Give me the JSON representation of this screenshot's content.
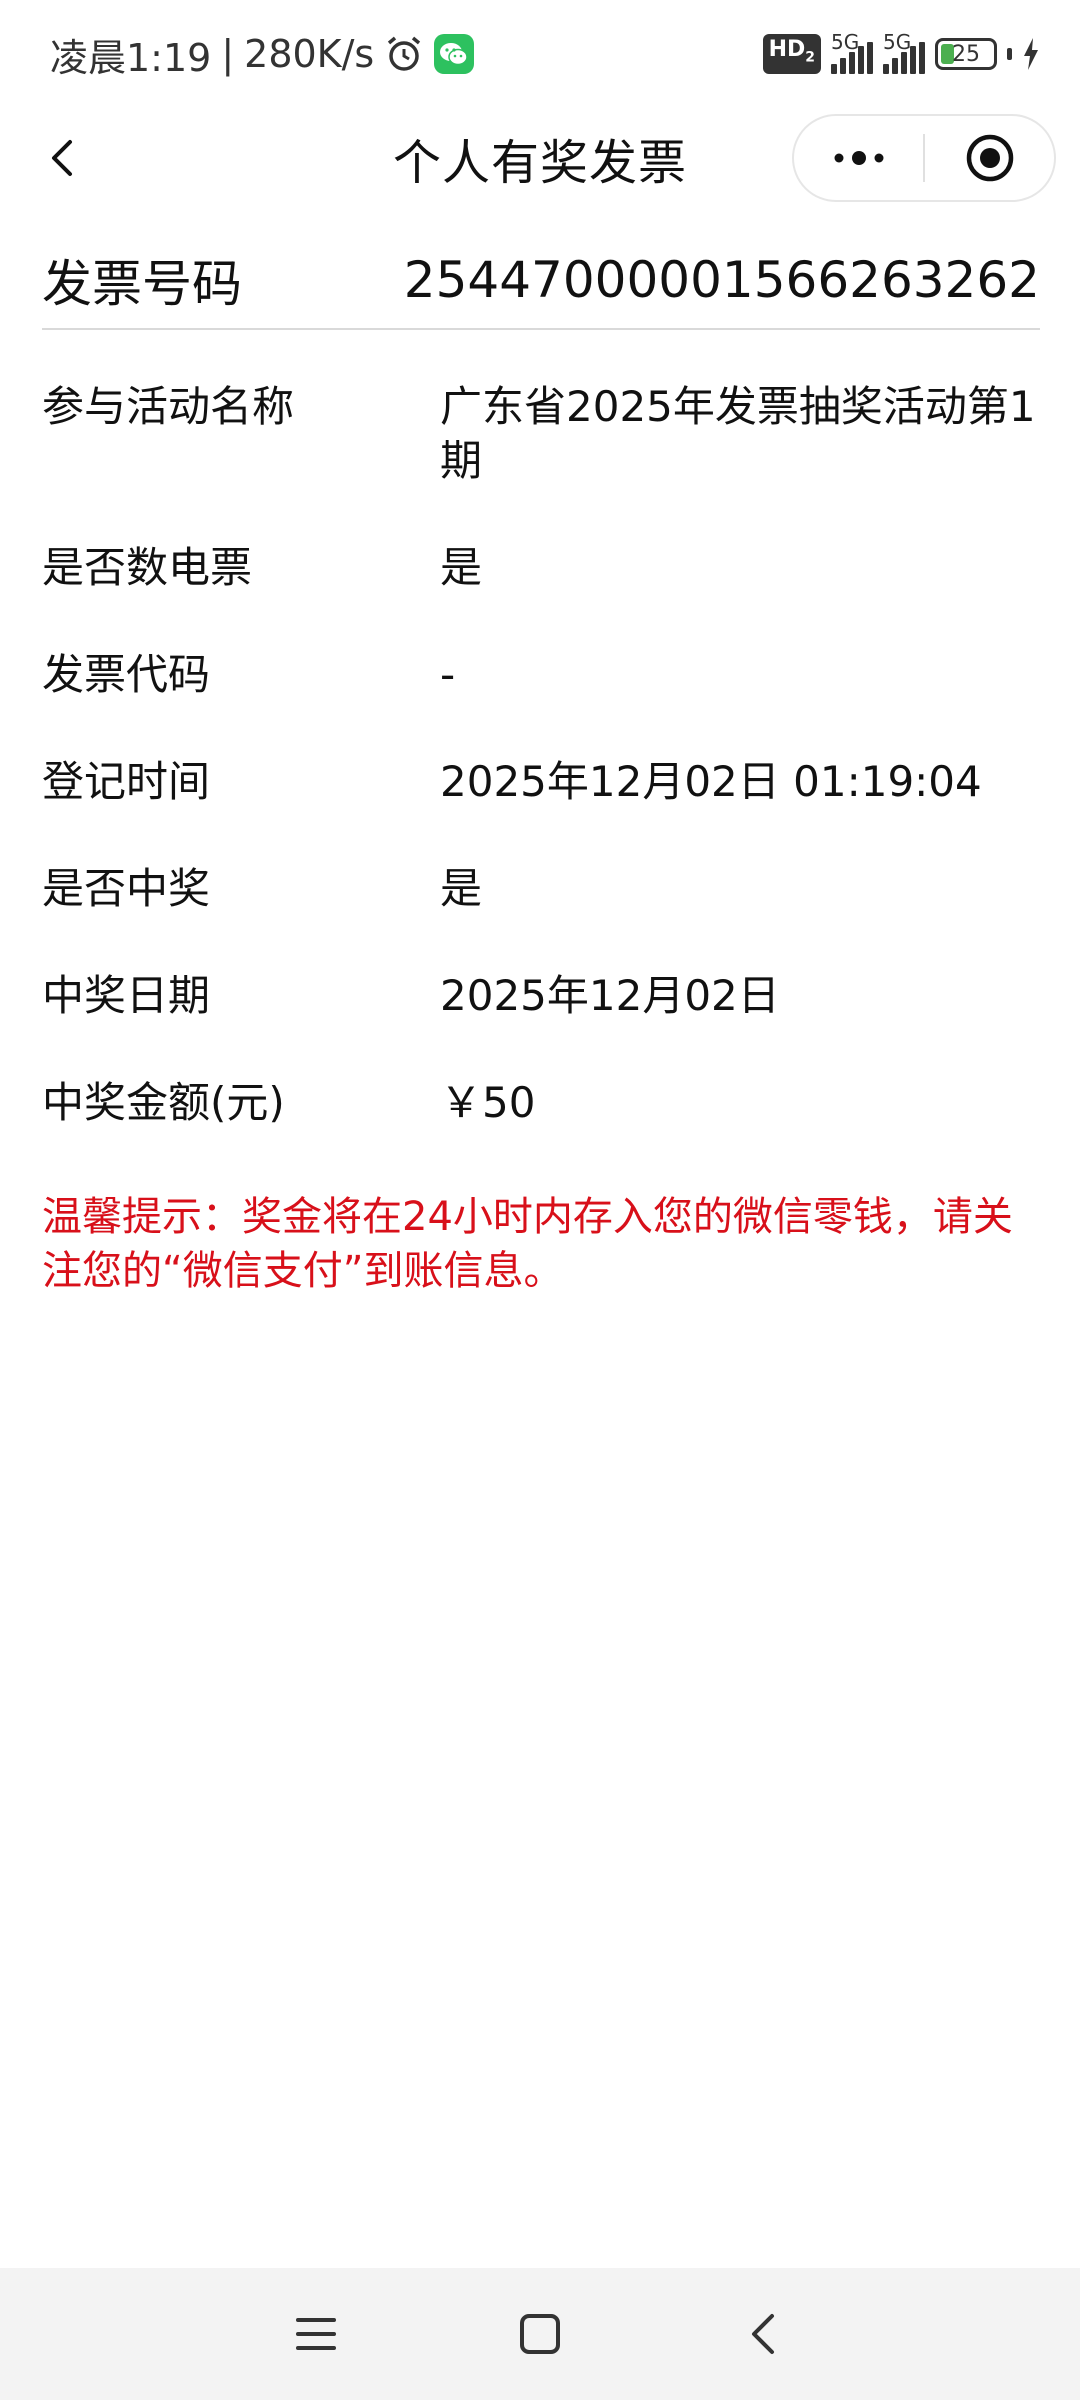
{
  "status_bar": {
    "time": "凌晨1:19",
    "speed": "280K/s",
    "hd_label": "HD",
    "hd_sub": "2",
    "sim1": "5G",
    "sim2": "5G",
    "battery": "25",
    "battery_level": 0.25
  },
  "header": {
    "title": "个人有奖发票"
  },
  "invoice": {
    "label": "发票号码",
    "value": "25447000001566263262"
  },
  "details": [
    {
      "label": "参与活动名称",
      "value": "广东省2025年发票抽奖活动第1期"
    },
    {
      "label": "是否数电票",
      "value": "是"
    },
    {
      "label": "发票代码",
      "value": "-"
    },
    {
      "label": "登记时间",
      "value": "2025年12月02日 01:19:04"
    },
    {
      "label": "是否中奖",
      "value": "是"
    },
    {
      "label": "中奖日期",
      "value": "2025年12月02日"
    },
    {
      "label": "中奖金额(元)",
      "value": "￥50"
    }
  ],
  "tip": "温馨提示：奖金将在24小时内存入您的微信零钱，请关注您的“微信支付”到账信息。",
  "colors": {
    "tip": "#d8101a",
    "divider": "#d9d9d9",
    "nav_bg": "#f3f3f3"
  },
  "icons": {
    "back": "chevron-left-icon",
    "more": "more-dots-icon",
    "close": "target-circle-icon",
    "nav_menu": "menu-icon",
    "nav_home": "square-home-icon",
    "nav_back": "chevron-left-icon"
  }
}
